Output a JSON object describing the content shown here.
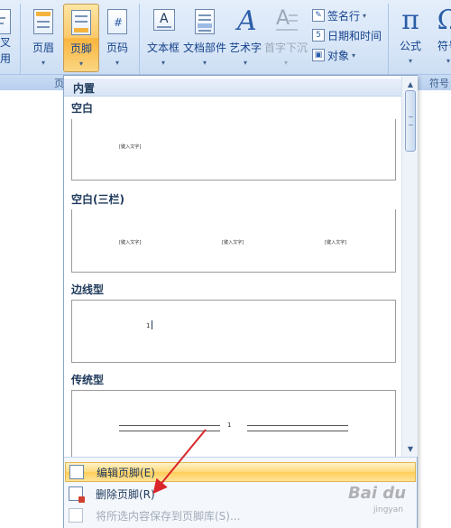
{
  "ribbon": {
    "partial_left_button": {
      "line1": "叉",
      "line2": "用"
    },
    "buttons": [
      {
        "id": "header",
        "label": "页眉"
      },
      {
        "id": "footer",
        "label": "页脚"
      },
      {
        "id": "page_number",
        "label": "页码"
      },
      {
        "id": "text_box",
        "label": "文本框"
      },
      {
        "id": "quick_parts",
        "label": "文档部件"
      },
      {
        "id": "wordart",
        "label": "艺术字"
      },
      {
        "id": "drop_cap",
        "label": "首字下沉"
      }
    ],
    "small_buttons": [
      {
        "id": "signature_line",
        "label": "签名行",
        "icon": "signature-icon"
      },
      {
        "id": "date_time",
        "label": "日期和时间",
        "icon": "calendar-icon",
        "icon_text": "5"
      },
      {
        "id": "object",
        "label": "对象",
        "icon": "object-icon"
      }
    ],
    "equation": {
      "glyph": "π",
      "label": "公式"
    },
    "symbol": {
      "glyph": "Ω",
      "label": "符号"
    },
    "group_labels": {
      "header_footer": "页",
      "symbols": "符号"
    },
    "footer_arrow": "▾",
    "arrow": "▾"
  },
  "gallery": {
    "section": "内置",
    "items": [
      {
        "title": "空白",
        "placeholders": [
          "[键入文字]"
        ]
      },
      {
        "title": "空白(三栏)",
        "placeholders": [
          "[键入文字]",
          "[键入文字]",
          "[键入文字]"
        ]
      },
      {
        "title": "边线型",
        "placeholders": [
          "1"
        ]
      },
      {
        "title": "传统型",
        "placeholders": [
          "1"
        ]
      }
    ],
    "scroll_up": "▲",
    "scroll_down": "▼"
  },
  "commands": [
    {
      "label": "编辑页脚(E)",
      "state": "hot"
    },
    {
      "label": "删除页脚(R)",
      "state": "normal"
    },
    {
      "label": "将所选内容保存到页脚库(S)...",
      "state": "disabled"
    }
  ],
  "watermark": {
    "main": "Bai du",
    "sub": "jingyan"
  },
  "colors": {
    "accent": "#fcc96a",
    "ribbon": "#d5e4f6",
    "arrow": "#d9262a"
  }
}
